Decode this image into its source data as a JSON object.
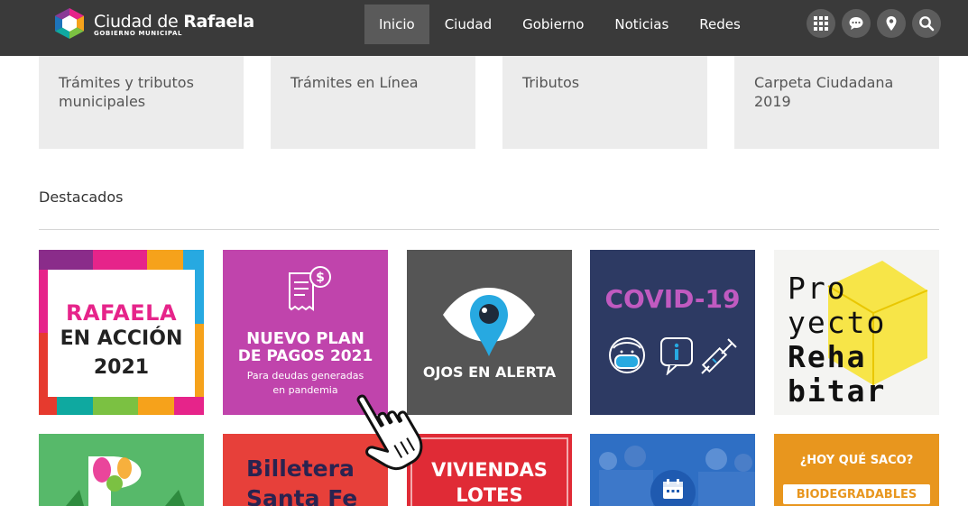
{
  "header": {
    "brand_prefix": "Ciudad de",
    "brand_bold": "Rafaela",
    "brand_sub": "GOBIERNO MUNICIPAL",
    "nav": [
      "Inicio",
      "Ciudad",
      "Gobierno",
      "Noticias",
      "Redes"
    ],
    "active_nav": "Inicio",
    "tools": [
      "apps-grid-icon",
      "chat-icon",
      "location-pin-icon",
      "search-icon"
    ]
  },
  "quick_links": [
    "Trámites y tributos municipales",
    "Trámites en Línea",
    "Tributos",
    "Carpeta Ciudadana 2019"
  ],
  "featured": {
    "title": "Destacados",
    "cards": {
      "rafaela_accion": {
        "l1": "RAFAELA",
        "l2": "EN ACCIÓN",
        "l3": "2021"
      },
      "plan_pagos": {
        "l1": "NUEVO PLAN",
        "l2": "DE PAGOS 2021",
        "l3": "Para deudas generadas",
        "l4": "en pandemia"
      },
      "ojos_alerta": {
        "l1": "OJOS EN ALERTA"
      },
      "covid": {
        "l1": "COVID-19"
      },
      "rehabitar": {
        "l1": "Pro",
        "l2": "yecto",
        "l3": "Reha",
        "l4": "bitar"
      },
      "billetera": {
        "l1": "Billetera",
        "l2": "Santa Fe"
      },
      "viviendas": {
        "l1": "VIVIENDAS",
        "l2": "LOTES"
      },
      "hoy_saco": {
        "l1": "¿HOY QUÉ SACO?",
        "l2": "BIODEGRADABLES"
      }
    }
  },
  "colors": {
    "topbar": "#3a3a3a",
    "plan_pagos_bg": "#c044ac",
    "ojos_bg": "#555555",
    "covid_bg": "#2d3a63",
    "covid_text": "#c05ac0",
    "billetera_bg": "#e7403a",
    "viviendas_bg": "#e02b36",
    "saco_bg": "#e8961e"
  }
}
